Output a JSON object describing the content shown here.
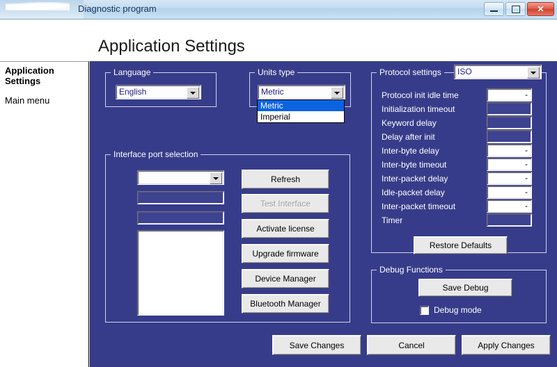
{
  "window": {
    "title": "Diagnostic program",
    "minimize_label": "Minimize",
    "maximize_label": "Maximize",
    "close_label": "✕"
  },
  "header": {
    "page_title": "Application Settings"
  },
  "sidebar": {
    "heading": "Application Settings",
    "items": [
      {
        "label": "Main menu"
      }
    ]
  },
  "language_group": {
    "legend": "Language",
    "selected": "English"
  },
  "units_group": {
    "legend": "Units type",
    "selected": "Metric",
    "open": true,
    "options": [
      {
        "label": "Metric",
        "selected": true
      },
      {
        "label": "Imperial",
        "selected": false
      }
    ]
  },
  "interface_group": {
    "legend": "Interface port selection",
    "port_combo_value": "",
    "info_field_1": "",
    "info_field_2": "-",
    "list_items": [],
    "buttons": [
      {
        "label": "Refresh",
        "enabled": true
      },
      {
        "label": "Test Interface",
        "enabled": false
      },
      {
        "label": "Activate license",
        "enabled": true
      },
      {
        "label": "Upgrade firmware",
        "enabled": true
      },
      {
        "label": "Device Manager",
        "enabled": true
      },
      {
        "label": "Bluetooth Manager",
        "enabled": true
      }
    ]
  },
  "protocol_group": {
    "legend": "Protocol settings",
    "protocol_selected": "ISO",
    "rows": [
      {
        "label": "Protocol init idle time",
        "value": "-",
        "enabled": true
      },
      {
        "label": "Initialization timeout",
        "value": "",
        "enabled": false
      },
      {
        "label": "Keyword delay",
        "value": "",
        "enabled": false
      },
      {
        "label": "Delay after init",
        "value": "",
        "enabled": false
      },
      {
        "label": "Inter-byte delay",
        "value": "-",
        "enabled": true
      },
      {
        "label": "Inter-byte timeout",
        "value": "-",
        "enabled": true
      },
      {
        "label": "Inter-packet delay",
        "value": "-",
        "enabled": true
      },
      {
        "label": "Idle-packet delay",
        "value": "-",
        "enabled": true
      },
      {
        "label": "Inter-packet timeout",
        "value": "-",
        "enabled": true
      },
      {
        "label": "Timer",
        "value": "",
        "enabled": false
      }
    ],
    "restore_defaults_label": "Restore Defaults"
  },
  "debug_group": {
    "legend": "Debug Functions",
    "save_debug_label": "Save Debug",
    "debug_mode_label": "Debug mode",
    "debug_mode_checked": false
  },
  "footer": {
    "save_label": "Save Changes",
    "cancel_label": "Cancel",
    "apply_label": "Apply Changes"
  },
  "colors": {
    "panel_navy": "#373c8a",
    "highlight_blue": "#0a64e0",
    "combo_text": "#20208a",
    "close_red": "#cf3f2c"
  }
}
